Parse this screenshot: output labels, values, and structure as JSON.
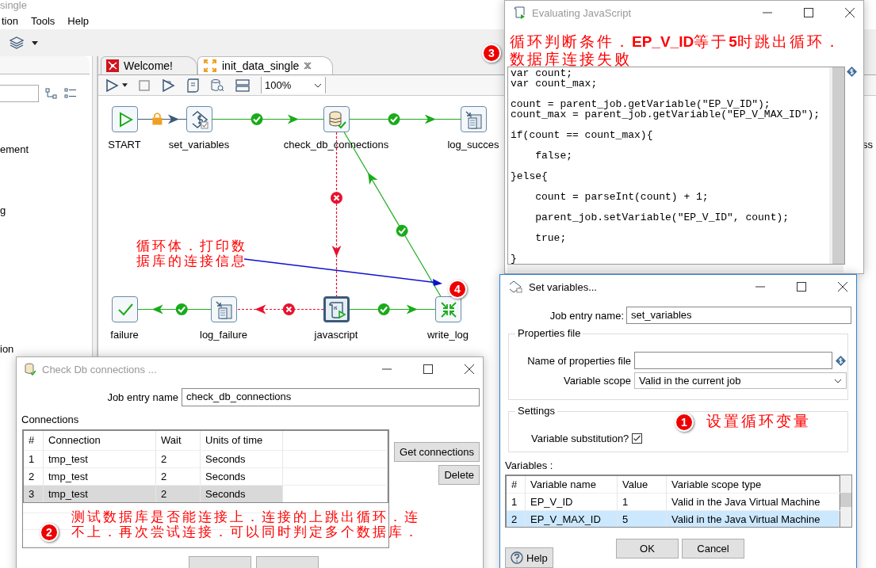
{
  "app": {
    "title": "single",
    "menu": [
      {
        "label": "tion"
      },
      {
        "label": "Tools"
      },
      {
        "label": "Help"
      }
    ]
  },
  "side_items": [
    "ement",
    "g",
    "ion"
  ],
  "tabs": [
    {
      "label": "Welcome!",
      "kind": "welcome",
      "selected": false,
      "closable": false
    },
    {
      "label": "init_data_single",
      "kind": "job",
      "selected": true,
      "closable": true
    }
  ],
  "zoom": "100%",
  "canvas": {
    "nodes": [
      {
        "label": "START",
        "kind": "start",
        "selected": false
      },
      {
        "label": "set_variables",
        "kind": "variables",
        "selected": false
      },
      {
        "label": "check_db_connections",
        "kind": "db_check",
        "selected": false
      },
      {
        "label": "log_succes",
        "kind": "log",
        "selected": false
      },
      {
        "label": "ss",
        "kind": "partial"
      },
      {
        "label": "failure",
        "kind": "success",
        "selected": false
      },
      {
        "label": "log_failure",
        "kind": "log",
        "selected": false
      },
      {
        "label": "javascript",
        "kind": "script",
        "selected": true
      },
      {
        "label": "write_log",
        "kind": "write_log",
        "selected": false
      }
    ],
    "hops": [
      {
        "kind": "unconditional"
      },
      {
        "kind": "success"
      },
      {
        "kind": "success"
      },
      {
        "kind": "failure"
      },
      {
        "kind": "failure"
      },
      {
        "kind": "success"
      },
      {
        "kind": "success"
      },
      {
        "kind": "success"
      }
    ]
  },
  "js_dialog": {
    "title": "Evaluating JavaScript",
    "code": "var count;\nvar count_max;\n\ncount = parent_job.getVariable(\"EP_V_ID\");\ncount_max = parent_job.getVariable(\"EP_V_MAX_ID\");\n\nif(count == count_max){\n\n    false;\n\n}else{\n\n    count = parseInt(count) + 1;\n\n    parent_job.setVariable(\"EP_V_ID\", count);\n\n    true;\n\n}"
  },
  "set_dialog": {
    "title": "Set variables...",
    "entry_label": "Job entry name:",
    "entry_value": "set_variables",
    "properties_group": "Properties file",
    "file_label": "Name of properties file",
    "scope_label": "Variable scope",
    "scope_value": "Valid in the current job",
    "settings_group": "Settings",
    "substitution_label": "Variable substitution?",
    "substitution_checked": true,
    "variables_label": "Variables :",
    "columns": [
      "#",
      "Variable name",
      "Value",
      "Variable scope type"
    ],
    "rows": [
      {
        "cells": [
          "1",
          "EP_V_ID",
          "1",
          "Valid in the Java Virtual Machine"
        ],
        "selected": false
      },
      {
        "cells": [
          "2",
          "EP_V_MAX_ID",
          "5",
          "Valid in the Java Virtual Machine"
        ],
        "selected": true
      }
    ],
    "buttons": [
      "OK",
      "Cancel"
    ],
    "help": "Help"
  },
  "check_dialog": {
    "title": "Check Db connections ...",
    "entry_label": "Job entry name",
    "entry_value": "check_db_connections",
    "connections_label": "Connections",
    "columns": [
      "#",
      "Connection",
      "Wait",
      "Units of time"
    ],
    "rows": [
      {
        "cells": [
          "1",
          "tmp_test",
          "2",
          "Seconds"
        ],
        "selected": false
      },
      {
        "cells": [
          "2",
          "tmp_test",
          "2",
          "Seconds"
        ],
        "selected": false
      },
      {
        "cells": [
          "3",
          "tmp_test",
          "2",
          "Seconds"
        ],
        "selected": true
      }
    ],
    "side_buttons": [
      "Get connections",
      "Delete"
    ]
  },
  "annotations": [
    {
      "number": "1",
      "text": "设置循环变量"
    },
    {
      "number": "2",
      "text": "测试数据库是否能连接上．连接的上跳出循环．连不上．再次尝试连接．可以同时判定多个数据库．"
    },
    {
      "number": "3",
      "text": "循环判断条件．**EP_V_ID**等于**5**时跳出循环．数据库连接失败"
    },
    {
      "number": "4",
      "text": "循环体．打印数据库的连接信息"
    }
  ]
}
